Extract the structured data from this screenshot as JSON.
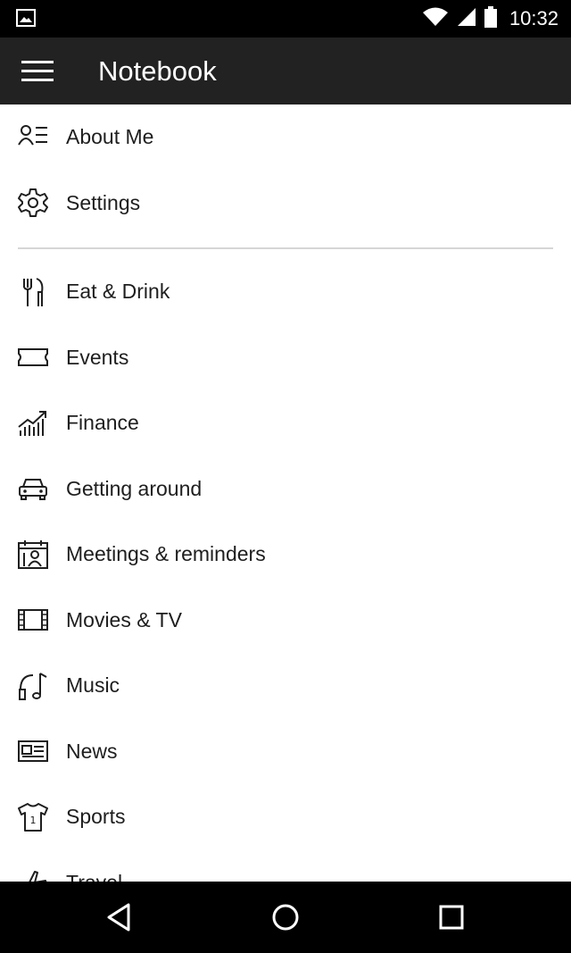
{
  "status_bar": {
    "time": "10:32",
    "icons": [
      "image-notification-icon",
      "wifi-icon",
      "cell-signal-icon",
      "battery-icon"
    ]
  },
  "app_bar": {
    "title": "Notebook",
    "menu_icon": "hamburger-menu-icon"
  },
  "menu": {
    "top_items": [
      {
        "label": "About Me",
        "icon": "person-list-icon"
      },
      {
        "label": "Settings",
        "icon": "gear-icon"
      }
    ],
    "category_items": [
      {
        "label": "Eat & Drink",
        "icon": "fork-knife-icon"
      },
      {
        "label": "Events",
        "icon": "ticket-icon"
      },
      {
        "label": "Finance",
        "icon": "chart-up-icon"
      },
      {
        "label": "Getting around",
        "icon": "car-icon"
      },
      {
        "label": "Meetings & reminders",
        "icon": "calendar-people-icon"
      },
      {
        "label": "Movies & TV",
        "icon": "film-icon"
      },
      {
        "label": "Music",
        "icon": "headphones-music-icon"
      },
      {
        "label": "News",
        "icon": "newspaper-icon"
      },
      {
        "label": "Sports",
        "icon": "jersey-icon"
      },
      {
        "label": "Travel",
        "icon": "airplane-icon"
      }
    ]
  },
  "nav_bar": {
    "icons": [
      "back-icon",
      "home-icon",
      "recents-icon"
    ]
  },
  "colors": {
    "status_bar_bg": "#000000",
    "app_bar_bg": "#222222",
    "text": "#1e1e1e",
    "divider": "#d6d6d6"
  }
}
